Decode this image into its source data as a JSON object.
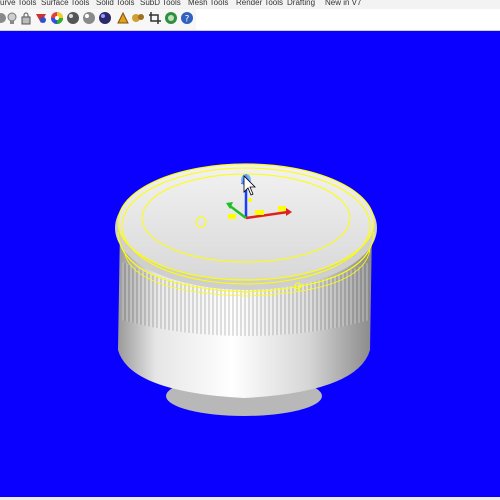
{
  "tabs": [
    "urve Tools",
    "Surface Tools",
    "Solid Tools",
    "SubD Tools",
    "Mesh Tools",
    "Render Tools",
    "Drafting",
    "New in V7"
  ],
  "toolbar_icons": [
    "standard-view-icon",
    "lightbulb-icon",
    "lock-icon",
    "material-icon",
    "color-wheel-icon",
    "render-sphere-icon",
    "environment-sphere-icon",
    "shaded-sphere-icon",
    "dark-sphere-icon",
    "sun-icon",
    "properties-icon",
    "crop-icon",
    "globe-render-icon",
    "help-icon"
  ],
  "viewport": {
    "background": "#0a00ff",
    "object": "cylindrical-cap-model",
    "selection_color": "#ffff00",
    "gizmo": {
      "z_axis_color": "#1a3cff",
      "x_axis_color": "#e02020",
      "y_axis_color": "#20c020"
    }
  }
}
